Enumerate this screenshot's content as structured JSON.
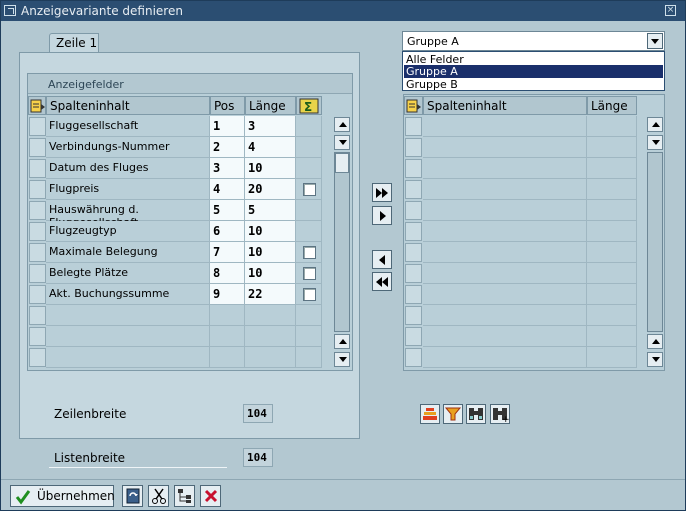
{
  "window": {
    "title": "Anzeigevariante definieren"
  },
  "tab": {
    "label": "Zeile 1"
  },
  "left": {
    "group_title": "Anzeigefelder",
    "headers": {
      "content": "Spalteninhalt",
      "pos": "Pos",
      "length": "Länge"
    },
    "rows": [
      {
        "name": "Fluggesellschaft",
        "pos": "1",
        "len": "3",
        "sum": false,
        "chk": false
      },
      {
        "name": "Verbindungs-Nummer",
        "pos": "2",
        "len": "4",
        "sum": false,
        "chk": false
      },
      {
        "name": "Datum des Fluges",
        "pos": "3",
        "len": "10",
        "sum": false,
        "chk": false
      },
      {
        "name": "Flugpreis",
        "pos": "4",
        "len": "20",
        "sum": true,
        "chk": false
      },
      {
        "name": "Hauswährung d. Fluggesellschaft",
        "pos": "5",
        "len": "5",
        "sum": false,
        "chk": false
      },
      {
        "name": "Flugzeugtyp",
        "pos": "6",
        "len": "10",
        "sum": false,
        "chk": false
      },
      {
        "name": "Maximale Belegung",
        "pos": "7",
        "len": "10",
        "sum": true,
        "chk": false
      },
      {
        "name": "Belegte Plätze",
        "pos": "8",
        "len": "10",
        "sum": true,
        "chk": false
      },
      {
        "name": "Akt. Buchungssumme",
        "pos": "9",
        "len": "22",
        "sum": true,
        "chk": false
      }
    ]
  },
  "right": {
    "combo_value": "Gruppe A",
    "options": [
      "Alle Felder",
      "Gruppe A",
      "Gruppe B"
    ],
    "selected_option": "Gruppe A",
    "headers": {
      "content": "Spalteninhalt",
      "length": "Länge"
    }
  },
  "footer": {
    "row_width_label": "Zeilenbreite",
    "row_width_value": "104",
    "list_width_label": "Listenbreite",
    "list_width_value": "104"
  },
  "buttons": {
    "apply": "Übernehmen"
  },
  "colors": {
    "titlebar": "#2b4e72",
    "background": "#b3c8d1",
    "selected": "#1a2f6b",
    "cancel": "#c8102e",
    "apply_check": "#1f8f1f"
  }
}
